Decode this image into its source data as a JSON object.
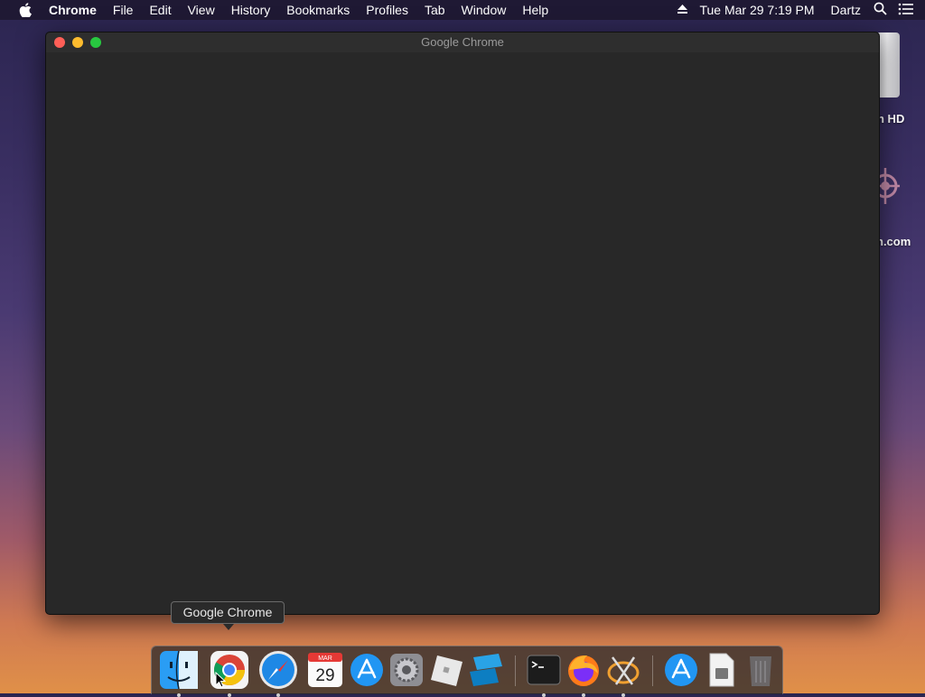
{
  "menubar": {
    "app_name": "Chrome",
    "menus": [
      "File",
      "Edit",
      "View",
      "History",
      "Bookmarks",
      "Profiles",
      "Tab",
      "Window",
      "Help"
    ],
    "clock": "Tue Mar 29  7:19 PM",
    "user": "Dartz"
  },
  "desktop": {
    "icon_labels": [
      "h HD",
      "n.com"
    ]
  },
  "window": {
    "title": "Google Chrome"
  },
  "tooltip": {
    "text": "Google Chrome"
  },
  "dock": {
    "calendar_month": "MAR",
    "calendar_day": "29",
    "items": [
      "finder-icon",
      "chrome-icon",
      "safari-icon",
      "calendar-icon",
      "app-store-icon",
      "system-preferences-icon",
      "roblox-icon",
      "roblox-studio-icon",
      "terminal-icon",
      "firefox-icon",
      "xcode-like-icon",
      "app-store-folder-icon",
      "file-icon",
      "trash-icon"
    ]
  },
  "colors": {
    "close": "#ff5f57",
    "minimize": "#febc2e",
    "maximize": "#28c840",
    "window_bg": "#282828"
  }
}
